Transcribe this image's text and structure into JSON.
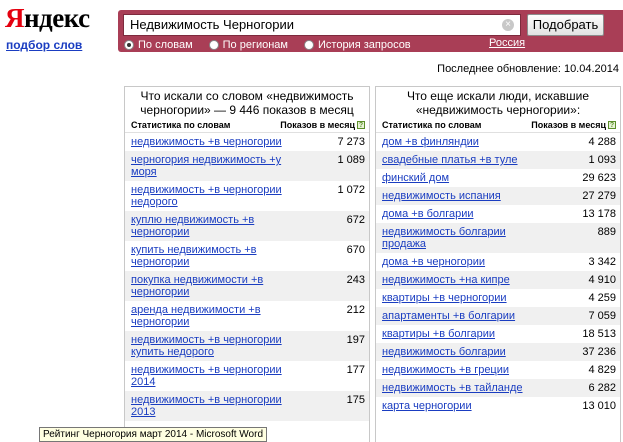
{
  "logo": {
    "first_letter": "Я",
    "rest": "ндекс"
  },
  "nav": {
    "title_link": "подбор слов"
  },
  "search": {
    "value": "Недвижимость Черногории",
    "submit_label": "Подобрать",
    "radios": [
      {
        "label": "По словам",
        "selected": true
      },
      {
        "label": "По регионам",
        "selected": false
      },
      {
        "label": "История запросов",
        "selected": false
      }
    ],
    "region": "Россия"
  },
  "last_updated": "Последнее обновление: 10.04.2014",
  "left_panel": {
    "title": "Что искали со словом «недвижимость черногории» — 9 446 показов в месяц",
    "col_phrase": "Статистика по словам",
    "col_count": "Показов в месяц",
    "rows": [
      {
        "phrase": "недвижимость +в черногории",
        "count": "7 273"
      },
      {
        "phrase": "черногория недвижимость +у моря",
        "count": "1 089"
      },
      {
        "phrase": "недвижимость +в черногории недорого",
        "count": "1 072"
      },
      {
        "phrase": "куплю недвижимость +в черногории",
        "count": "672"
      },
      {
        "phrase": "купить недвижимость +в черногории",
        "count": "670"
      },
      {
        "phrase": "покупка недвижимости +в черногории",
        "count": "243"
      },
      {
        "phrase": "аренда недвижимости +в черногории",
        "count": "212"
      },
      {
        "phrase": "недвижимость +в черногории купить недорого",
        "count": "197"
      },
      {
        "phrase": "недвижимость +в черногории 2014",
        "count": "177"
      },
      {
        "phrase": "недвижимость +в черногории 2013",
        "count": "175"
      }
    ]
  },
  "right_panel": {
    "title": "Что еще искали люди, искавшие «недвижимость черногории»:",
    "col_phrase": "Статистика по словам",
    "col_count": "Показов в месяц",
    "rows": [
      {
        "phrase": "дом +в финляндии",
        "count": "4 288"
      },
      {
        "phrase": "свадебные платья +в туле",
        "count": "1 093"
      },
      {
        "phrase": "финский дом",
        "count": "29 623"
      },
      {
        "phrase": "недвижимость испания",
        "count": "27 279"
      },
      {
        "phrase": "дома +в болгарии",
        "count": "13 178"
      },
      {
        "phrase": "недвижимость болгарии продажа",
        "count": "889"
      },
      {
        "phrase": "дома +в черногории",
        "count": "3 342"
      },
      {
        "phrase": "недвижимость +на кипре",
        "count": "4 910"
      },
      {
        "phrase": "квартиры +в черногории",
        "count": "4 259"
      },
      {
        "phrase": "апартаменты +в болгарии",
        "count": "7 059"
      },
      {
        "phrase": "квартиры +в болгарии",
        "count": "18 513"
      },
      {
        "phrase": "недвижимость болгарии",
        "count": "37 236"
      },
      {
        "phrase": "недвижимость +в греции",
        "count": "4 829"
      },
      {
        "phrase": "недвижимость +в тайланде",
        "count": "6 282"
      },
      {
        "phrase": "карта черногории",
        "count": "13 010"
      }
    ]
  },
  "tooltip": "Рейтинг Черногория март 2014 - Microsoft Word"
}
